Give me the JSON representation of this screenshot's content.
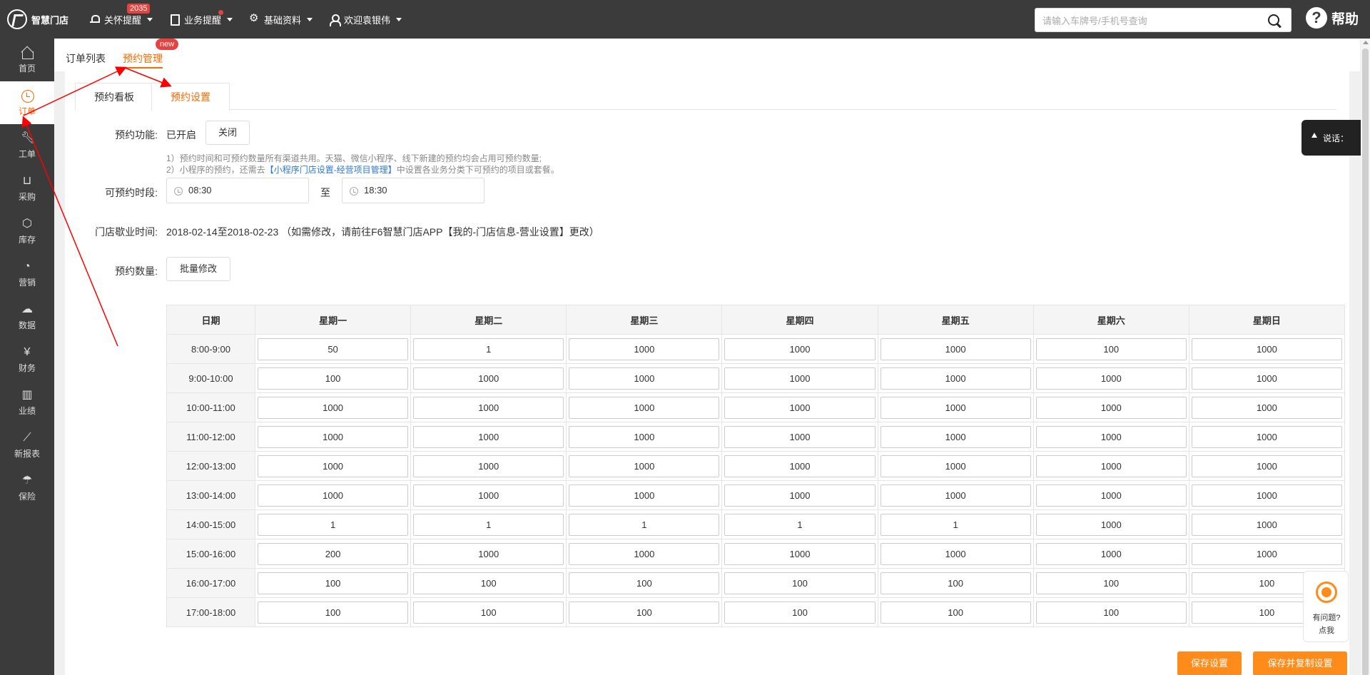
{
  "brand": {
    "name": "智慧门店"
  },
  "topnav": {
    "items": [
      {
        "label": "关怀提醒",
        "icon": "bell-icon",
        "badge": "2035"
      },
      {
        "label": "业务提醒",
        "icon": "doc-icon",
        "dot": true
      },
      {
        "label": "基础资料",
        "icon": "gear-icon"
      },
      {
        "label": "欢迎袁银伟",
        "icon": "user-icon"
      }
    ]
  },
  "search": {
    "placeholder": "请输入车牌号/手机号查询",
    "value": ""
  },
  "help": {
    "label": "帮助"
  },
  "sidebar": {
    "items": [
      {
        "label": "首页",
        "icon": "home-icon"
      },
      {
        "label": "订单",
        "icon": "clock-icon",
        "active": true
      },
      {
        "label": "工单",
        "icon": "wrench-icon"
      },
      {
        "label": "采购",
        "icon": "cart-icon"
      },
      {
        "label": "库存",
        "icon": "box-icon"
      },
      {
        "label": "营销",
        "icon": "pie-icon"
      },
      {
        "label": "数据",
        "icon": "cloud-icon"
      },
      {
        "label": "财务",
        "icon": "yen-icon"
      },
      {
        "label": "业绩",
        "icon": "bar-chart-icon"
      },
      {
        "label": "新报表",
        "icon": "line-chart-icon"
      },
      {
        "label": "保险",
        "icon": "umbrella-icon"
      }
    ]
  },
  "subtabs": {
    "list": "订单列表",
    "manage": "预约管理",
    "new_badge": "new"
  },
  "tabs": {
    "board": "预约看板",
    "settings": "预约设置"
  },
  "form": {
    "function_label": "预约功能:",
    "function_status": "已开启",
    "close_button": "关闭",
    "note1": "1）预约时间和可预约数量所有渠道共用。天猫、微信小程序、线下新建的预约均会占用可预约数量;",
    "note2_prefix": "2）小程序的预约，还需去",
    "note2_link": "【小程序门店设置-经营项目管理】",
    "note2_suffix": "中设置各业务分类下可预约的项目或套餐。",
    "period_label": "可预约时段:",
    "start_time": "08:30",
    "to_label": "至",
    "end_time": "18:30",
    "closed_label": "门店歇业时间:",
    "closed_text": "2018-02-14至2018-02-23 （如需修改，请前往F6智慧门店APP【我的-门店信息-营业设置】更改）",
    "count_label": "预约数量:",
    "batch_button": "批量修改"
  },
  "schedule": {
    "headers": [
      "日期",
      "星期一",
      "星期二",
      "星期三",
      "星期四",
      "星期五",
      "星期六",
      "星期日"
    ],
    "rows": [
      {
        "time": "8:00-9:00",
        "values": [
          "50",
          "1",
          "1000",
          "1000",
          "1000",
          "100",
          "1000"
        ]
      },
      {
        "time": "9:00-10:00",
        "values": [
          "100",
          "1000",
          "1000",
          "1000",
          "1000",
          "1000",
          "1000"
        ]
      },
      {
        "time": "10:00-11:00",
        "values": [
          "1000",
          "1000",
          "1000",
          "1000",
          "1000",
          "1000",
          "1000"
        ]
      },
      {
        "time": "11:00-12:00",
        "values": [
          "1000",
          "1000",
          "1000",
          "1000",
          "1000",
          "1000",
          "1000"
        ]
      },
      {
        "time": "12:00-13:00",
        "values": [
          "1000",
          "1000",
          "1000",
          "1000",
          "1000",
          "1000",
          "1000"
        ]
      },
      {
        "time": "13:00-14:00",
        "values": [
          "1000",
          "1000",
          "1000",
          "1000",
          "1000",
          "1000",
          "1000"
        ]
      },
      {
        "time": "14:00-15:00",
        "values": [
          "1",
          "1",
          "1",
          "1",
          "1",
          "1000",
          "1000"
        ]
      },
      {
        "time": "15:00-16:00",
        "values": [
          "200",
          "1000",
          "1000",
          "1000",
          "1000",
          "1000",
          "1000"
        ]
      },
      {
        "time": "16:00-17:00",
        "values": [
          "100",
          "100",
          "100",
          "100",
          "100",
          "100",
          "100"
        ]
      },
      {
        "time": "17:00-18:00",
        "values": [
          "100",
          "100",
          "100",
          "100",
          "100",
          "100",
          "100"
        ]
      }
    ]
  },
  "actions": {
    "save": "保存设置",
    "save_copy": "保存并复制设置"
  },
  "chat": {
    "label": "说话："
  },
  "help_float": {
    "line1": "有问题?",
    "line2": "点我"
  },
  "colors": {
    "accent": "#ff8c1a",
    "topbar": "#3b3b3b",
    "badge": "#e64340",
    "link": "#2f7ad8",
    "annotation": "#ff0000"
  }
}
